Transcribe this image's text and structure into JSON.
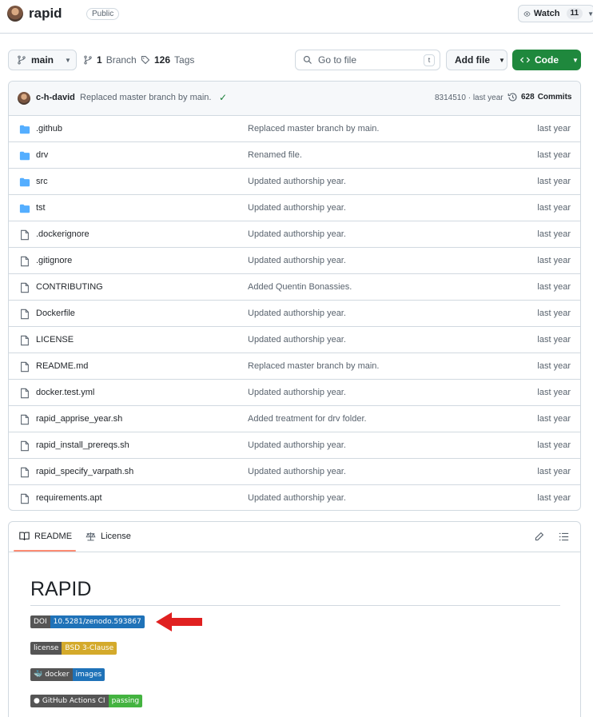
{
  "header": {
    "repo_name": "rapid",
    "visibility": "Public",
    "watch_label": "Watch",
    "watch_count": "11"
  },
  "toolbar": {
    "branch": "main",
    "branches_count": "1",
    "branches_label": "Branch",
    "tags_count": "126",
    "tags_label": "Tags",
    "goto_placeholder": "Go to file",
    "goto_shortcut": "t",
    "addfile_label": "Add file",
    "code_label": "Code"
  },
  "commit": {
    "author": "c-h-david",
    "message": "Replaced master branch by main.",
    "hash": "8314510",
    "time": "last year",
    "commits_count": "628",
    "commits_label": "Commits"
  },
  "files": [
    {
      "name": ".github",
      "type": "dir",
      "message": "Replaced master branch by main.",
      "time": "last year"
    },
    {
      "name": "drv",
      "type": "dir",
      "message": "Renamed file.",
      "time": "last year"
    },
    {
      "name": "src",
      "type": "dir",
      "message": "Updated authorship year.",
      "time": "last year"
    },
    {
      "name": "tst",
      "type": "dir",
      "message": "Updated authorship year.",
      "time": "last year"
    },
    {
      "name": ".dockerignore",
      "type": "file",
      "message": "Updated authorship year.",
      "time": "last year"
    },
    {
      "name": ".gitignore",
      "type": "file",
      "message": "Updated authorship year.",
      "time": "last year"
    },
    {
      "name": "CONTRIBUTING",
      "type": "file",
      "message": "Added Quentin Bonassies.",
      "time": "last year"
    },
    {
      "name": "Dockerfile",
      "type": "file",
      "message": "Updated authorship year.",
      "time": "last year"
    },
    {
      "name": "LICENSE",
      "type": "file",
      "message": "Updated authorship year.",
      "time": "last year"
    },
    {
      "name": "README.md",
      "type": "file",
      "message": "Replaced master branch by main.",
      "time": "last year"
    },
    {
      "name": "docker.test.yml",
      "type": "file",
      "message": "Updated authorship year.",
      "time": "last year"
    },
    {
      "name": "rapid_apprise_year.sh",
      "type": "file",
      "message": "Added treatment for drv folder.",
      "time": "last year"
    },
    {
      "name": "rapid_install_prereqs.sh",
      "type": "file",
      "message": "Updated authorship year.",
      "time": "last year"
    },
    {
      "name": "rapid_specify_varpath.sh",
      "type": "file",
      "message": "Updated authorship year.",
      "time": "last year"
    },
    {
      "name": "requirements.apt",
      "type": "file",
      "message": "Updated authorship year.",
      "time": "last year"
    }
  ],
  "readme": {
    "tab_readme": "README",
    "tab_license": "License",
    "title": "RAPID",
    "badges": [
      {
        "left": "DOI",
        "right": "10.5281/zenodo.593867",
        "right_color": "#1f72b8"
      },
      {
        "left": "license",
        "right": "BSD 3-Clause",
        "right_color": "#d4aa2b"
      },
      {
        "left": "docker",
        "right": "images",
        "right_color": "#1f72b8"
      },
      {
        "left": "GitHub Actions CI",
        "right": "passing",
        "right_color": "#44b340"
      }
    ]
  },
  "colors": {
    "code_button": "#1f883d",
    "folder_icon": "#54aeff",
    "annotation_arrow": "#e02020"
  }
}
